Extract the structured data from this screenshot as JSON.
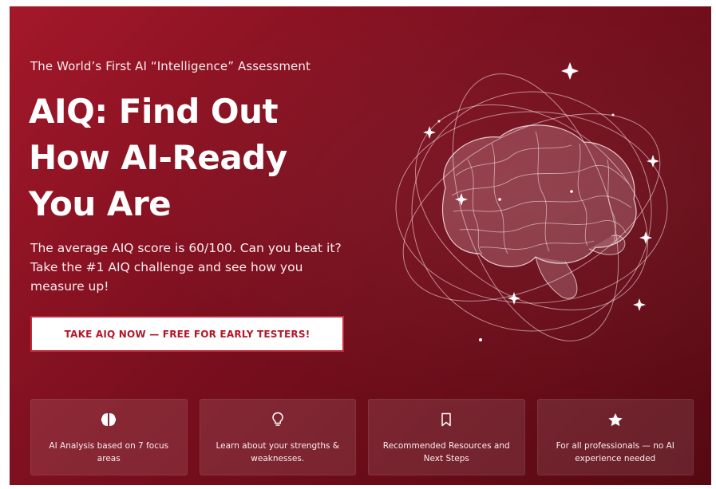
{
  "hero": {
    "eyebrow": "The World’s First AI “Intelligence” Assessment",
    "headline": [
      "AIQ: Find Out",
      "How AI-Ready",
      "You Are"
    ],
    "description": "The average AIQ score is 60/100. Can you beat it? Take the #1 AIQ challenge and see how you measure up!",
    "cta_label": "TAKE AIQ NOW — FREE FOR EARLY TESTERS!"
  },
  "features": [
    {
      "icon": "brain-icon",
      "label": "AI Analysis based on 7 focus areas"
    },
    {
      "icon": "lightbulb-icon",
      "label": "Learn about your strengths & weaknesses."
    },
    {
      "icon": "bookmark-icon",
      "label": "Recommended Resources and Next Steps"
    },
    {
      "icon": "star-icon",
      "label": "For all professionals — no AI experience needed"
    }
  ],
  "colors": {
    "background_start": "#a3182a",
    "background_end": "#560912",
    "cta_text": "#b41627",
    "cta_border": "#c22a3a",
    "text": "#ffffff"
  }
}
